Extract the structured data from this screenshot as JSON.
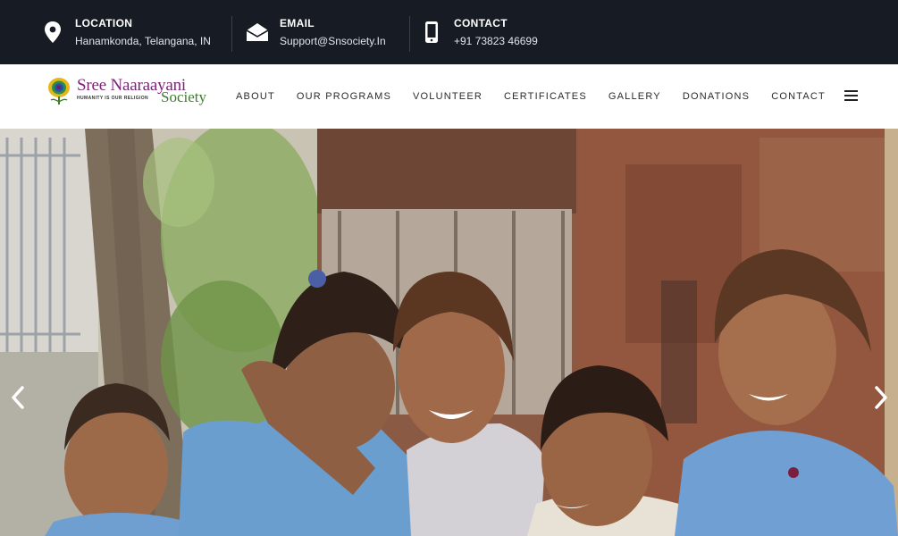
{
  "topbar": {
    "location": {
      "icon": "location-pin-icon",
      "label": "LOCATION",
      "value": "Hanamkonda, Telangana, IN"
    },
    "email": {
      "icon": "envelope-icon",
      "label": "EMAIL",
      "value": "Support@Snsociety.In"
    },
    "contact": {
      "icon": "mobile-phone-icon",
      "label": "CONTACT",
      "value": "+91 73823 46699"
    },
    "bg_color": "#171b24"
  },
  "logo": {
    "name_line1": "Sree Naaraayani",
    "name_line2": "Society",
    "tagline": "HUMANITY IS OUR RELIGION",
    "brand_color": "#7d2378",
    "accent_color": "#3c7d2a"
  },
  "nav": {
    "items": [
      "ABOUT",
      "OUR PROGRAMS",
      "VOLUNTEER",
      "CERTIFICATES",
      "GALLERY",
      "DONATIONS",
      "CONTACT"
    ],
    "menu_icon": "hamburger-menu-icon"
  },
  "hero": {
    "image": "photo of smiling children in blue school uniforms",
    "prev_icon": "chevron-left-icon",
    "next_icon": "chevron-right-icon"
  }
}
